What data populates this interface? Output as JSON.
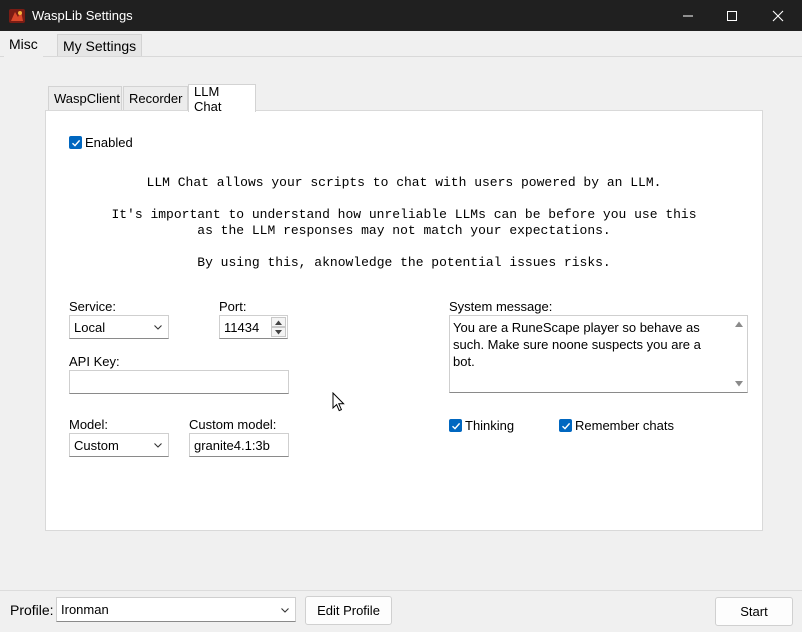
{
  "window": {
    "title": "WaspLib Settings"
  },
  "outer_tabs": [
    {
      "label": "Misc"
    },
    {
      "label": "My Settings"
    }
  ],
  "inner_tabs": [
    {
      "label": "WaspClient"
    },
    {
      "label": "Recorder"
    },
    {
      "label": "LLM Chat"
    }
  ],
  "llm": {
    "enabled_label": "Enabled",
    "info_line1": "LLM Chat allows your scripts to chat with users powered by an LLM.",
    "info_line2": "It's important to understand how unreliable LLMs can be before you use this",
    "info_line3": "as the LLM responses may not match your expectations.",
    "info_line4": "By using this, aknowledge the potential issues risks.",
    "service_label": "Service:",
    "service_value": "Local",
    "port_label": "Port:",
    "port_value": "11434",
    "api_key_label": "API Key:",
    "api_key_value": "",
    "model_label": "Model:",
    "model_value": "Custom",
    "custom_model_label": "Custom model:",
    "custom_model_value": "granite4.1:3b",
    "system_message_label": "System message:",
    "system_message_value": "You are a RuneScape player so behave as such. Make sure noone suspects you are a bot.",
    "thinking_label": "Thinking",
    "remember_label": "Remember chats"
  },
  "footer": {
    "profile_label": "Profile:",
    "profile_value": "Ironman",
    "edit_profile_label": "Edit Profile",
    "start_label": "Start"
  },
  "colors": {
    "accent": "#0067c0",
    "titlebar": "#202020"
  },
  "icons": [
    "app-icon",
    "minimize-icon",
    "maximize-icon",
    "close-icon",
    "chevron-down-icon",
    "checkmark-icon",
    "spin-up-icon",
    "spin-down-icon",
    "scroll-up-icon",
    "scroll-down-icon"
  ]
}
